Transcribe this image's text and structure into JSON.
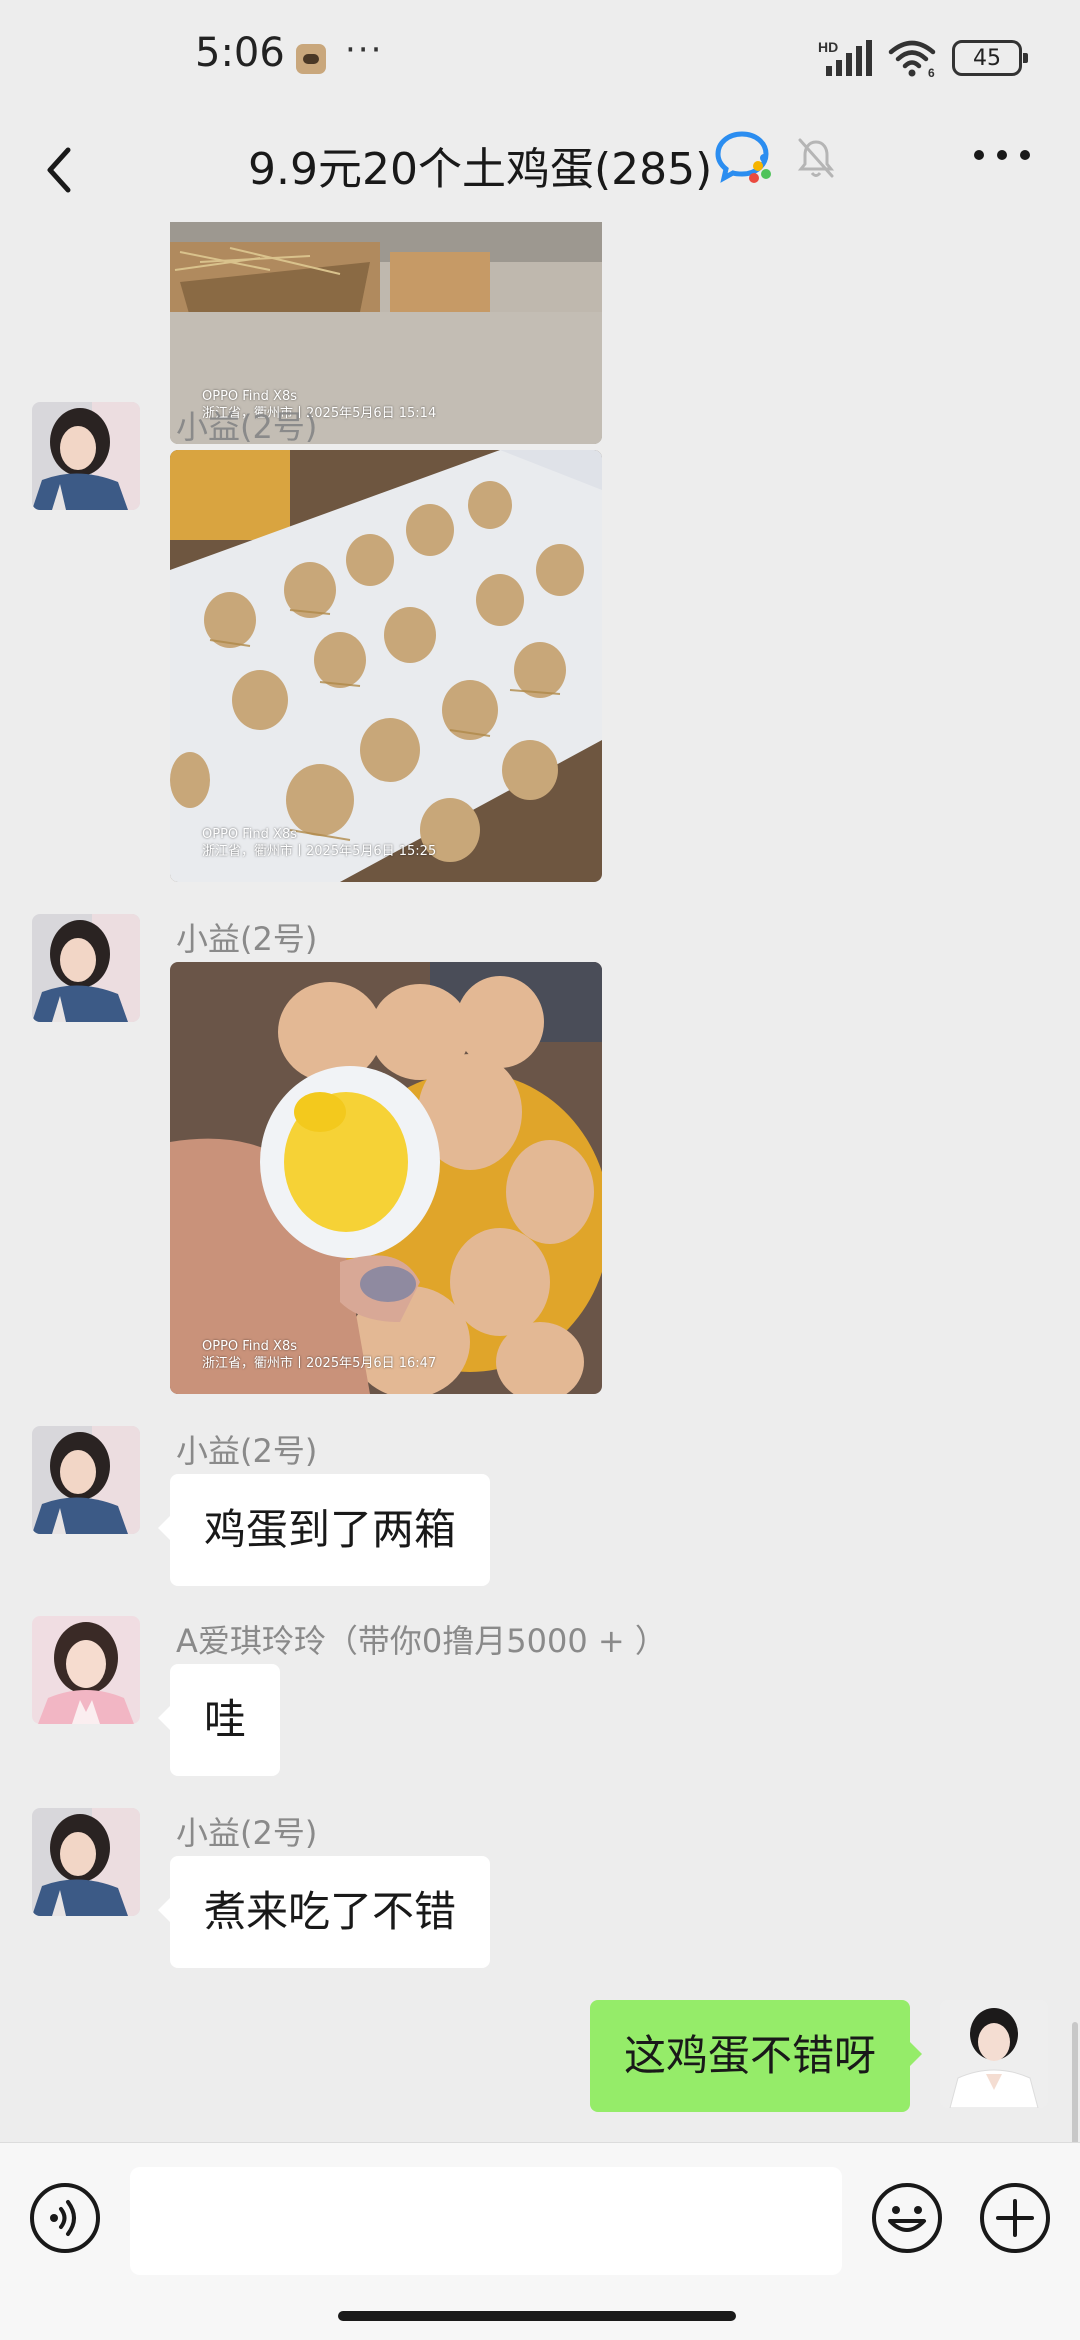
{
  "status_bar": {
    "time": "5:06",
    "dots": "···",
    "network": "HD",
    "battery": "45"
  },
  "header": {
    "title": "9.9元20个土鸡蛋(285)"
  },
  "messages": {
    "m0": {
      "caption_device": "OPPO Find X8s",
      "caption_location": "浙江省，衢州市丨2025年5月6日 15:14"
    },
    "m1": {
      "sender": "小益(2号)",
      "caption_device": "OPPO Find X8s",
      "caption_location": "浙江省，衢州市丨2025年5月6日 15:25"
    },
    "m2": {
      "sender": "小益(2号)",
      "caption_device": "OPPO Find X8s",
      "caption_location": "浙江省，衢州市丨2025年5月6日 16:47"
    },
    "m3": {
      "sender": "小益(2号)",
      "text": "鸡蛋到了两箱"
    },
    "m4": {
      "sender": "A爱琪玲玲（带你0撸月5000 + ）",
      "text": "哇"
    },
    "m5": {
      "sender": "小益(2号)",
      "text": "煮来吃了不错"
    },
    "m6": {
      "text": "这鸡蛋不错呀"
    }
  },
  "input_bar": {
    "placeholder": ""
  },
  "colors": {
    "background": "#ededed",
    "incoming_bubble": "#ffffff",
    "outgoing_bubble": "#95ec69",
    "sender_name": "#8a8a8a"
  }
}
